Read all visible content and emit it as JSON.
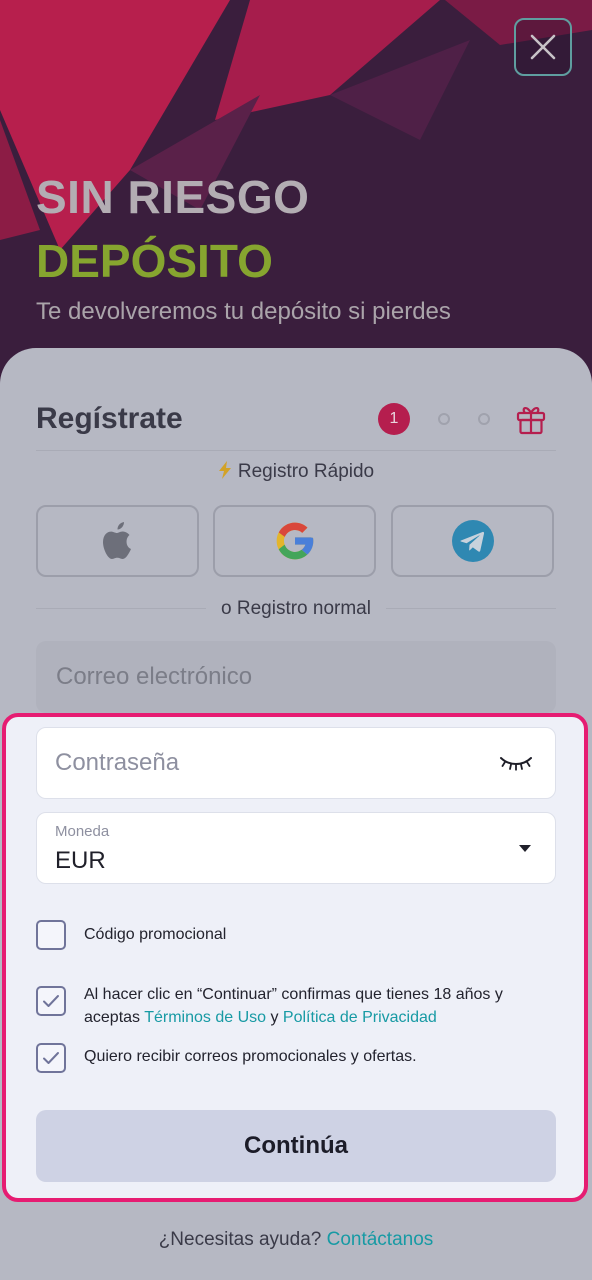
{
  "hero": {
    "close_icon": "close-icon",
    "title": "SIN RIESGO",
    "highlight": "DEPÓSITO",
    "subtitle": "Te devolveremos tu depósito si pierdes"
  },
  "register": {
    "title": "Regístrate",
    "steps": {
      "active_step": "1",
      "total_dots": 2,
      "reward_icon": "gift-icon"
    },
    "quick_label": "Registro Rápido",
    "quick_icon": "lightning-icon",
    "social": [
      {
        "name": "apple",
        "icon": "apple-icon"
      },
      {
        "name": "google",
        "icon": "google-icon"
      },
      {
        "name": "telegram",
        "icon": "telegram-icon"
      }
    ],
    "normal_label": "o Registro normal",
    "email_placeholder": "Correo electrónico",
    "password_placeholder": "Contraseña",
    "password_toggle_icon": "eye-closed-icon",
    "currency_label": "Moneda",
    "currency_value": "EUR",
    "promo_label": "Código promocional",
    "promo_checked": false,
    "terms_text_1": "Al hacer clic en “Continuar” confirmas que tienes 18 años y",
    "terms_text_2": "aceptas ",
    "terms_link": "Términos de Uso",
    "terms_and": " y ",
    "privacy_link": "Política de Privacidad",
    "terms_checked": true,
    "newsletter_label": "Quiero recibir correos promocionales y ofertas.",
    "newsletter_checked": true,
    "continue_label": "Continúa"
  },
  "footer": {
    "help_text": "¿Necesitas ayuda? ",
    "contact_link": "Contáctanos"
  },
  "colors": {
    "accent_pink": "#e61c72",
    "step_active": "#b51e4e",
    "highlight_green": "#86a52f",
    "link_teal": "#179aa4"
  }
}
